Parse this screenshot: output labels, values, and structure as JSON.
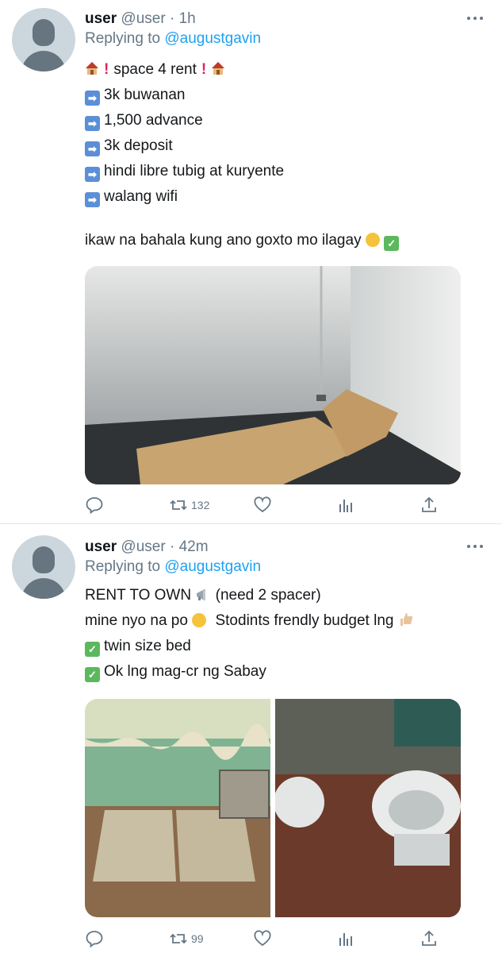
{
  "tweets": [
    {
      "name": "user",
      "handle": "@user",
      "time": "1h",
      "replying_prefix": "Replying to",
      "replying_to": "@augustgavin",
      "lines": [
        "space 4 rent",
        "3k buwanan",
        "1,500 advance",
        "3k deposit",
        "hindi libre tubig at kuryente",
        "walang wifi",
        "ikaw na bahala kung ano goxto mo ilagay"
      ],
      "photos": [
        "empty room with cardboard on floor"
      ],
      "retweets": "132"
    },
    {
      "name": "user",
      "handle": "@user",
      "time": "42m",
      "replying_prefix": "Replying to",
      "replying_to": "@augustgavin",
      "lines": [
        "RENT TO OWN",
        "(need 2 spacer)",
        "mine nyo na po",
        "Stodints frendly budget lng",
        "twin size bed",
        "Ok lng mag-cr ng Sabay"
      ],
      "photos": [
        "room with two old mattresses",
        "two toilets side by side"
      ],
      "retweets": "99"
    }
  ],
  "icons": [
    "reply-icon",
    "retweet-icon",
    "like-icon",
    "analytics-icon",
    "share-icon",
    "more-icon"
  ],
  "colors": {
    "link": "#1da1f2",
    "meta": "#657786",
    "divider": "#e1e8ed"
  }
}
